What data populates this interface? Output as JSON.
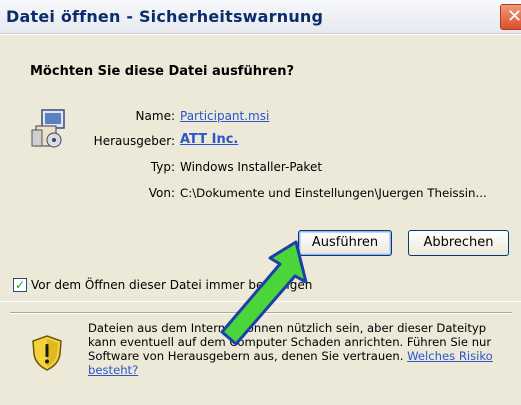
{
  "window": {
    "title": "Datei öffnen - Sicherheitswarnung",
    "close_glyph": "✕"
  },
  "dialog": {
    "question": "Möchten Sie diese Datei ausführen?",
    "fields": {
      "name_label": "Name:",
      "name_value": "Participant.msi",
      "publisher_label": "Herausgeber:",
      "publisher_value": "ATT Inc.",
      "type_label": "Typ:",
      "type_value": "Windows Installer-Paket",
      "from_label": "Von:",
      "from_value": "C:\\Dokumente und Einstellungen\\Juergen Theissin..."
    },
    "buttons": {
      "run": "Ausführen",
      "cancel": "Abbrechen"
    },
    "checkbox": {
      "label": "Vor dem Öffnen dieser Datei immer bestätigen",
      "checked": true
    },
    "warning": {
      "text": "Dateien aus dem Internet können nützlich sein, aber dieser Dateityp kann eventuell auf dem Computer Schaden anrichten. Führen Sie nur Software von Herausgebern aus, denen Sie vertrauen.",
      "link": "Welches Risiko besteht?"
    }
  },
  "colors": {
    "title_text": "#0c2d6b",
    "link": "#2b55c9",
    "arrow_fill": "#4ad63a",
    "arrow_stroke": "#1c3fa8",
    "dialog_bg": "#ece9d8"
  },
  "icons": {
    "file": "installer-package-icon",
    "warning": "security-shield-icon",
    "pointer": "green-arrow-annotation"
  }
}
